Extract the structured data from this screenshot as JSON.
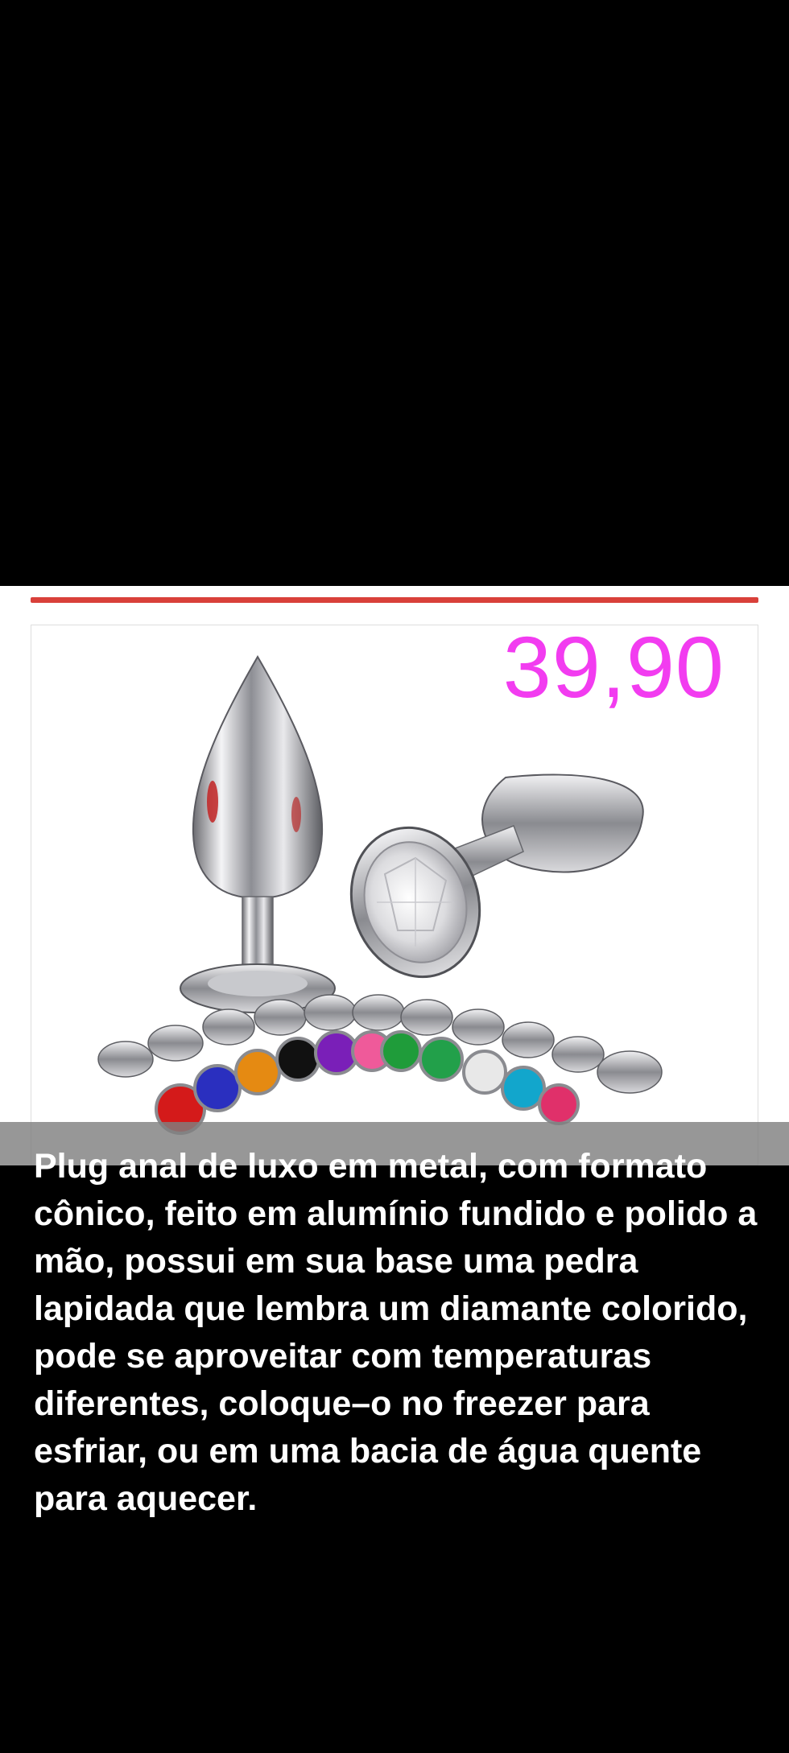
{
  "product": {
    "price": "39,90",
    "description": "Plug anal de luxo em metal, com formato\ncônico, feito em alumínio fundido e polido a\nmão, possui em sua base uma pedra\nlapidada que lembra um diamante colorido,\npode se aproveitar com temperaturas\ndiferentes, coloque–o no freezer para\nesfriar, ou em uma bacia de água quente\npara aquecer."
  },
  "colors": {
    "price": "#f23cf0",
    "rule": "#d9403a",
    "background": "#000000",
    "gems": [
      "#d41a1a",
      "#2a2fbf",
      "#e58a12",
      "#111111",
      "#7a1fb8",
      "#ef5a9a",
      "#1f9c3a",
      "#22a04a",
      "#e8e8e8",
      "#12a6cc",
      "#e0306a"
    ]
  },
  "icons": {
    "product_photo": "metal-plug-product-photo"
  }
}
